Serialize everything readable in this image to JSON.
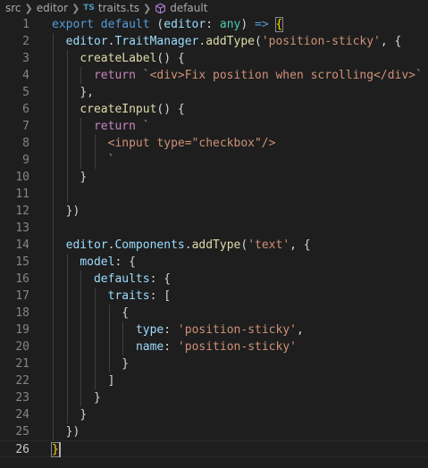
{
  "breadcrumb": {
    "src": "src",
    "editor": "editor",
    "ts_badge": "TS",
    "file": "traits.ts",
    "symbol": "default"
  },
  "code_lines": [
    {
      "n": "1",
      "indent": 0,
      "tokens": [
        [
          "kw",
          "export"
        ],
        [
          "plain",
          " "
        ],
        [
          "kw",
          "default"
        ],
        [
          "plain",
          " ("
        ],
        [
          "var",
          "editor"
        ],
        [
          "plain",
          ": "
        ],
        [
          "type",
          "any"
        ],
        [
          "plain",
          ") "
        ],
        [
          "kw",
          "=>"
        ],
        [
          "plain",
          " "
        ],
        [
          "bm",
          "{"
        ]
      ]
    },
    {
      "n": "2",
      "indent": 1,
      "tokens": [
        [
          "var",
          "editor"
        ],
        [
          "plain",
          "."
        ],
        [
          "var",
          "TraitManager"
        ],
        [
          "plain",
          "."
        ],
        [
          "fn",
          "addType"
        ],
        [
          "plain",
          "("
        ],
        [
          "str",
          "'position-sticky'"
        ],
        [
          "plain",
          ", {"
        ]
      ]
    },
    {
      "n": "3",
      "indent": 2,
      "tokens": [
        [
          "fn",
          "createLabel"
        ],
        [
          "plain",
          "() {"
        ]
      ]
    },
    {
      "n": "4",
      "indent": 3,
      "tokens": [
        [
          "kwc",
          "return"
        ],
        [
          "plain",
          " "
        ],
        [
          "str",
          "`<div>Fix position when scrolling</div>`"
        ]
      ]
    },
    {
      "n": "5",
      "indent": 2,
      "tokens": [
        [
          "plain",
          "},"
        ]
      ]
    },
    {
      "n": "6",
      "indent": 2,
      "tokens": [
        [
          "fn",
          "createInput"
        ],
        [
          "plain",
          "() {"
        ]
      ]
    },
    {
      "n": "7",
      "indent": 3,
      "tokens": [
        [
          "kwc",
          "return"
        ],
        [
          "plain",
          " "
        ],
        [
          "str",
          "`"
        ]
      ]
    },
    {
      "n": "8",
      "indent": 4,
      "tokens": [
        [
          "str",
          "<input type=\"checkbox\"/>"
        ]
      ]
    },
    {
      "n": "9",
      "indent": 4,
      "tokens": [
        [
          "str",
          "`"
        ]
      ]
    },
    {
      "n": "10",
      "indent": 2,
      "tokens": [
        [
          "plain",
          "}"
        ]
      ]
    },
    {
      "n": "11",
      "indent": 2,
      "tokens": []
    },
    {
      "n": "12",
      "indent": 1,
      "tokens": [
        [
          "plain",
          "})"
        ]
      ]
    },
    {
      "n": "13",
      "indent": 1,
      "tokens": []
    },
    {
      "n": "14",
      "indent": 1,
      "tokens": [
        [
          "var",
          "editor"
        ],
        [
          "plain",
          "."
        ],
        [
          "var",
          "Components"
        ],
        [
          "plain",
          "."
        ],
        [
          "fn",
          "addType"
        ],
        [
          "plain",
          "("
        ],
        [
          "str",
          "'text'"
        ],
        [
          "plain",
          ", {"
        ]
      ]
    },
    {
      "n": "15",
      "indent": 2,
      "tokens": [
        [
          "var",
          "model"
        ],
        [
          "plain",
          ": {"
        ]
      ]
    },
    {
      "n": "16",
      "indent": 3,
      "tokens": [
        [
          "var",
          "defaults"
        ],
        [
          "plain",
          ": {"
        ]
      ]
    },
    {
      "n": "17",
      "indent": 4,
      "tokens": [
        [
          "var",
          "traits"
        ],
        [
          "plain",
          ": ["
        ]
      ]
    },
    {
      "n": "18",
      "indent": 5,
      "tokens": [
        [
          "plain",
          "{"
        ]
      ]
    },
    {
      "n": "19",
      "indent": 6,
      "tokens": [
        [
          "var",
          "type"
        ],
        [
          "plain",
          ": "
        ],
        [
          "str",
          "'position-sticky'"
        ],
        [
          "plain",
          ","
        ]
      ]
    },
    {
      "n": "20",
      "indent": 6,
      "tokens": [
        [
          "var",
          "name"
        ],
        [
          "plain",
          ": "
        ],
        [
          "str",
          "'position-sticky'"
        ]
      ]
    },
    {
      "n": "21",
      "indent": 5,
      "tokens": [
        [
          "plain",
          "}"
        ]
      ]
    },
    {
      "n": "22",
      "indent": 4,
      "tokens": [
        [
          "plain",
          "]"
        ]
      ]
    },
    {
      "n": "23",
      "indent": 3,
      "tokens": [
        [
          "plain",
          "}"
        ]
      ]
    },
    {
      "n": "24",
      "indent": 2,
      "tokens": [
        [
          "plain",
          "}"
        ]
      ]
    },
    {
      "n": "25",
      "indent": 1,
      "tokens": [
        [
          "plain",
          "})"
        ]
      ]
    },
    {
      "n": "26",
      "indent": 0,
      "tokens": [
        [
          "bm",
          "}"
        ]
      ]
    }
  ],
  "current_line": "26",
  "colors": {
    "background": "#1e1e1e",
    "keyword": "#569cd6",
    "control_keyword": "#c586c0",
    "function": "#dcdcaa",
    "variable": "#9cdcfe",
    "type": "#4ec9b0",
    "string": "#ce9178",
    "bracket_match": "#ffd700",
    "line_number": "#858585"
  }
}
